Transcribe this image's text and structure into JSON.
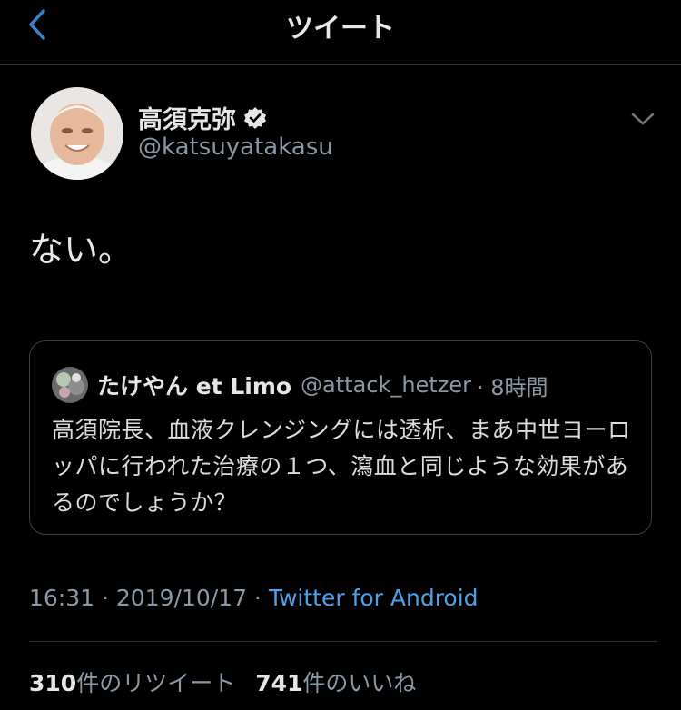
{
  "nav": {
    "title": "ツイート",
    "back_icon": "chevron-left-icon"
  },
  "tweet": {
    "author_name": "高須克弥",
    "author_handle": "@katsuyatakasu",
    "verified": true,
    "text": "ない。",
    "timestamp": "16:31 · 2019/10/17 · ",
    "source": "Twitter for Android"
  },
  "quote": {
    "author_name": "たけやん et Limo",
    "author_handle": "@attack_hetzer",
    "time": "· 8時間",
    "text": "高須院長、血液クレンジングには透析、まあ中世ヨーロッパに行われた治療の１つ、瀉血と同じような効果があるのでしょうか？"
  },
  "stats": {
    "retweet_count": "310",
    "retweet_label": "件のリツイート",
    "like_count": "741",
    "like_label": "件のいいね"
  },
  "colors": {
    "background": "#000000",
    "link": "#4ea1e8",
    "muted": "#8b98a5",
    "accent": "#3b82c4"
  }
}
